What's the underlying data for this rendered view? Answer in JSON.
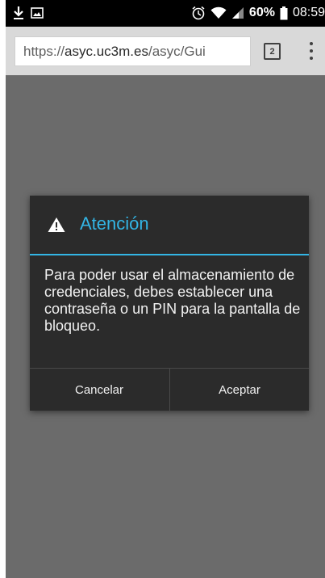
{
  "status_bar": {
    "battery": "60%",
    "time": "08:59",
    "icons": [
      "download-icon",
      "image-icon",
      "alarm-icon",
      "wifi-icon",
      "signal-icon",
      "battery-icon"
    ]
  },
  "browser": {
    "url_prefix": "https://",
    "url_host": "asyc.uc3m.es",
    "url_path": "/asyc/Gui",
    "tab_count": "2"
  },
  "dialog": {
    "title": "Atención",
    "message": "Para poder usar el almacenamiento de credenciales, debes establecer una contraseña o un PIN para la pantalla de bloqueo.",
    "cancel_label": "Cancelar",
    "accept_label": "Aceptar",
    "accent_color": "#33b5e5"
  }
}
